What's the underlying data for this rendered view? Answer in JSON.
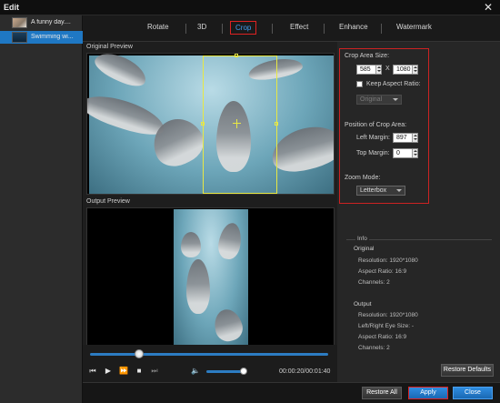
{
  "window": {
    "title": "Edit",
    "close_glyph": "✕"
  },
  "files": [
    {
      "name": "A funny day....",
      "selected": false
    },
    {
      "name": "Swimming wi...",
      "selected": true
    }
  ],
  "tabs": [
    "Rotate",
    "3D",
    "Crop",
    "Effect",
    "Enhance",
    "Watermark"
  ],
  "active_tab": "Crop",
  "previews": {
    "original_label": "Original Preview",
    "output_label": "Output Preview"
  },
  "crop": {
    "area_size_label": "Crop Area Size:",
    "width": "585",
    "x_separator": "X",
    "height": "1080",
    "keep_aspect_label": "Keep Aspect Ratio:",
    "keep_aspect_checked": false,
    "aspect_value": "Original",
    "position_label": "Position of Crop Area:",
    "left_margin_label": "Left Margin:",
    "left_margin": "897",
    "top_margin_label": "Top Margin:",
    "top_margin": "0",
    "zoom_label": "Zoom Mode:",
    "zoom_value": "Letterbox"
  },
  "info": {
    "heading": "Info",
    "original_heading": "Original",
    "original_lines": [
      "Resolution: 1920*1080",
      "Aspect Ratio: 16:9",
      "Channels: 2"
    ],
    "output_heading": "Output",
    "output_lines": [
      "Resolution: 1920*1080",
      "Left/Right Eye Size: -",
      "Aspect Ratio: 16:9",
      "Channels: 2"
    ]
  },
  "player": {
    "timecode": "00:00:20/00:01:40",
    "progress": 0.2,
    "volume": 0.85
  },
  "buttons": {
    "restore_defaults": "Restore Defaults",
    "restore_all": "Restore All",
    "apply": "Apply",
    "close": "Close"
  },
  "colors": {
    "accent": "#1f78c4",
    "highlight_border": "#cc2222",
    "crop_frame": "#e8e844"
  }
}
